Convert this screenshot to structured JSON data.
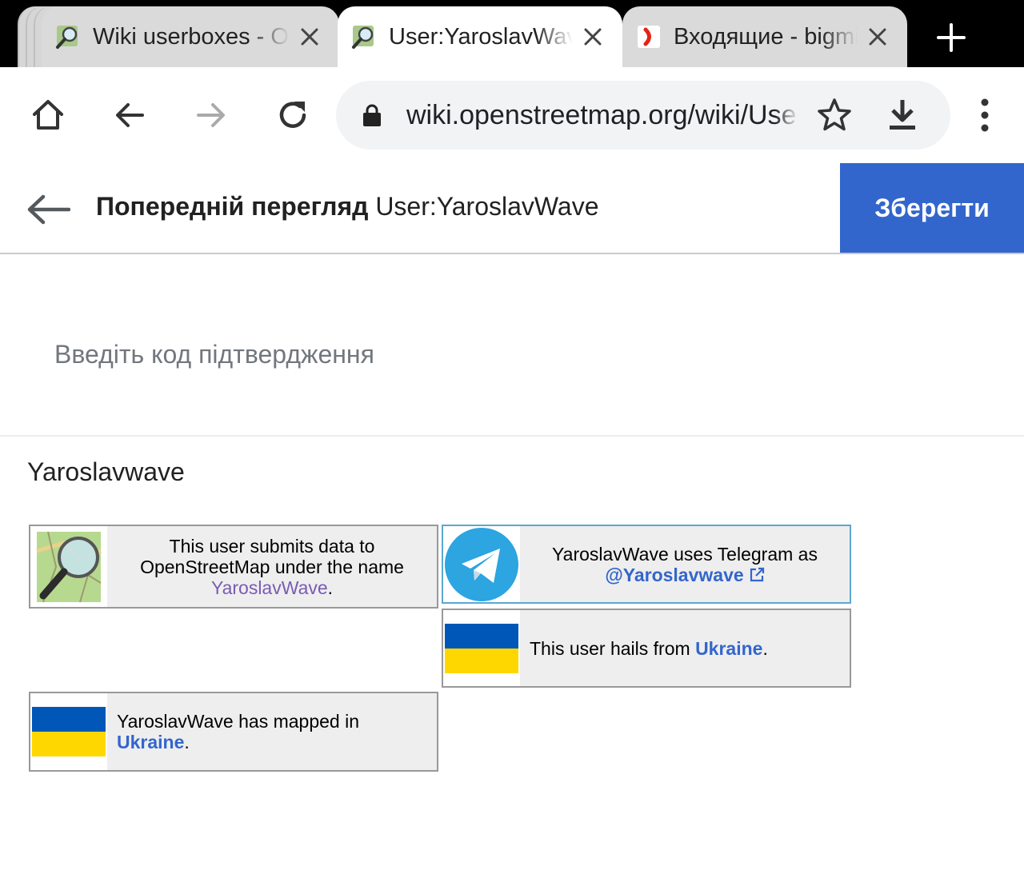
{
  "browser": {
    "tabs": [
      {
        "title": "Wiki userboxes - OpenStreetMap Wiki",
        "favicon": "osm-wiki-icon",
        "active": false
      },
      {
        "title": "User:YaroslavWave",
        "favicon": "osm-wiki-icon",
        "active": true
      },
      {
        "title": "Входящие - bigmir",
        "favicon": "mail-icon",
        "active": false
      }
    ],
    "url": "wiki.openstreetmap.org/wiki/User:YaroslavWave"
  },
  "editor": {
    "title_bold": "Попередній перегляд",
    "title_page": "User:YaroslavWave",
    "save_label": "Зберегти",
    "captcha_placeholder": "Введіть код підтвердження"
  },
  "content": {
    "heading": "Yaroslavwave",
    "userboxes": {
      "osm": {
        "text_before": "This user submits data to OpenStreetMap under the name ",
        "link": "YaroslavWave",
        "text_after": "."
      },
      "telegram": {
        "text_before": "YaroslavWave uses Telegram as",
        "link": "@Yaroslavwave"
      },
      "hails": {
        "text_before": "This user hails from ",
        "link": "Ukraine",
        "text_after": "."
      },
      "mapped": {
        "text_before": "YaroslavWave has mapped in ",
        "link": "Ukraine",
        "text_after": "."
      }
    }
  },
  "colors": {
    "accent": "#3366cc",
    "flag_blue": "#0057b7",
    "flag_yellow": "#ffd700",
    "telegram": "#2ca5e0"
  }
}
